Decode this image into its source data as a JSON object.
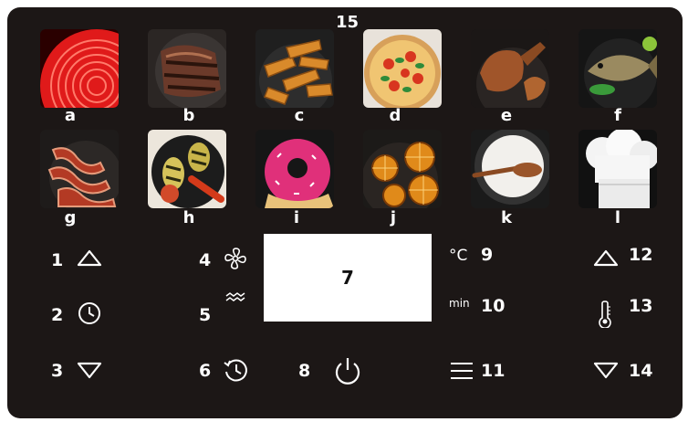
{
  "top_marker": "15",
  "tiles_row1": [
    {
      "label": "a",
      "icon": "hotplate-icon"
    },
    {
      "label": "b",
      "icon": "steak-icon"
    },
    {
      "label": "c",
      "icon": "potato-wedges-icon"
    },
    {
      "label": "d",
      "icon": "pizza-icon"
    },
    {
      "label": "e",
      "icon": "roast-chicken-icon"
    },
    {
      "label": "f",
      "icon": "fish-icon"
    }
  ],
  "tiles_row2": [
    {
      "label": "g",
      "icon": "bacon-icon"
    },
    {
      "label": "h",
      "icon": "grilled-vegetables-icon"
    },
    {
      "label": "i",
      "icon": "donut-icon"
    },
    {
      "label": "j",
      "icon": "dried-orange-icon"
    },
    {
      "label": "k",
      "icon": "yogurt-icon"
    },
    {
      "label": "l",
      "icon": "chef-hat-icon"
    }
  ],
  "controls": {
    "n1": "1",
    "n2": "2",
    "n3": "3",
    "n4": "4",
    "n5": "5",
    "n6": "6",
    "n7": "7",
    "n8": "8",
    "n9": "9",
    "n10": "10",
    "n11": "11",
    "n12": "12",
    "n13": "13",
    "n14": "14"
  },
  "units": {
    "temp": "°C",
    "min": "min"
  },
  "colors": {
    "panel": "#1c1716",
    "text": "#ffffff",
    "display": "#ffffff"
  }
}
